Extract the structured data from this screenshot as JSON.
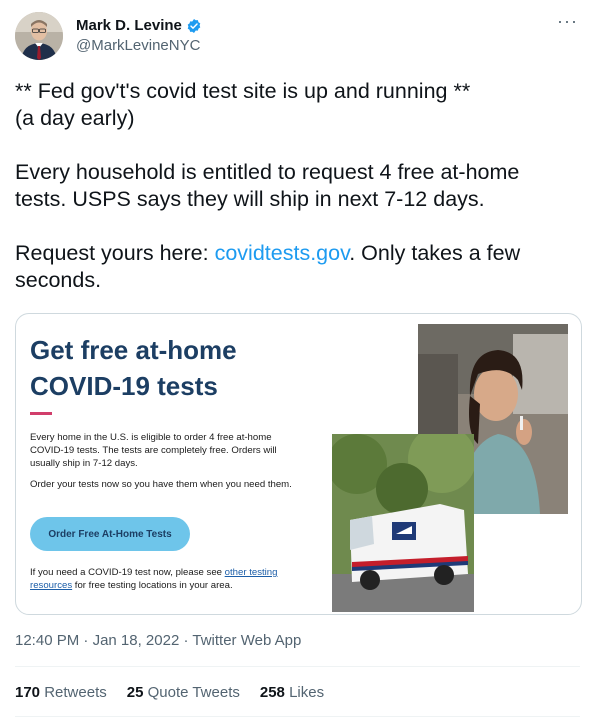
{
  "author": {
    "name": "Mark D. Levine",
    "handle": "@MarkLevineNYC",
    "verified": true,
    "avatar_icon": "profile-photo"
  },
  "menu_icon": "more-horizontal-icon",
  "tweet": {
    "para1": "** Fed gov't's covid test site is up and running **\n(a day early)",
    "para2": "Every household is entitled to request 4 free at-home tests. USPS says they will ship in next 7-12 days.",
    "para3_prefix": "Request yours here: ",
    "para3_link": "covidtests.gov",
    "para3_suffix": ".  Only takes a few seconds."
  },
  "card": {
    "title_line1": "Get free at-home",
    "title_line2": "COVID-19 tests",
    "body1": "Every home in the U.S. is eligible to order 4 free at-home COVID-19 tests. The tests are completely free. Orders will usually ship in 7-12 days.",
    "body2": "Order your tests now so you have them when you need them.",
    "button_label": "Order Free At-Home Tests",
    "foot_prefix": "If you need a COVID-19 test now, please see ",
    "foot_link": "other testing resources",
    "foot_suffix": " for free testing locations in your area.",
    "accent_color": "#d13e6b",
    "title_color": "#1c3e63",
    "button_color": "#6ec5ea"
  },
  "meta": {
    "time": "12:40 PM",
    "sep1": " · ",
    "date": "Jan 18, 2022",
    "sep2": " · ",
    "source": "Twitter Web App"
  },
  "stats": {
    "retweets_count": "170",
    "retweets_label": "Retweets",
    "quotes_count": "25",
    "quotes_label": "Quote Tweets",
    "likes_count": "258",
    "likes_label": "Likes"
  }
}
